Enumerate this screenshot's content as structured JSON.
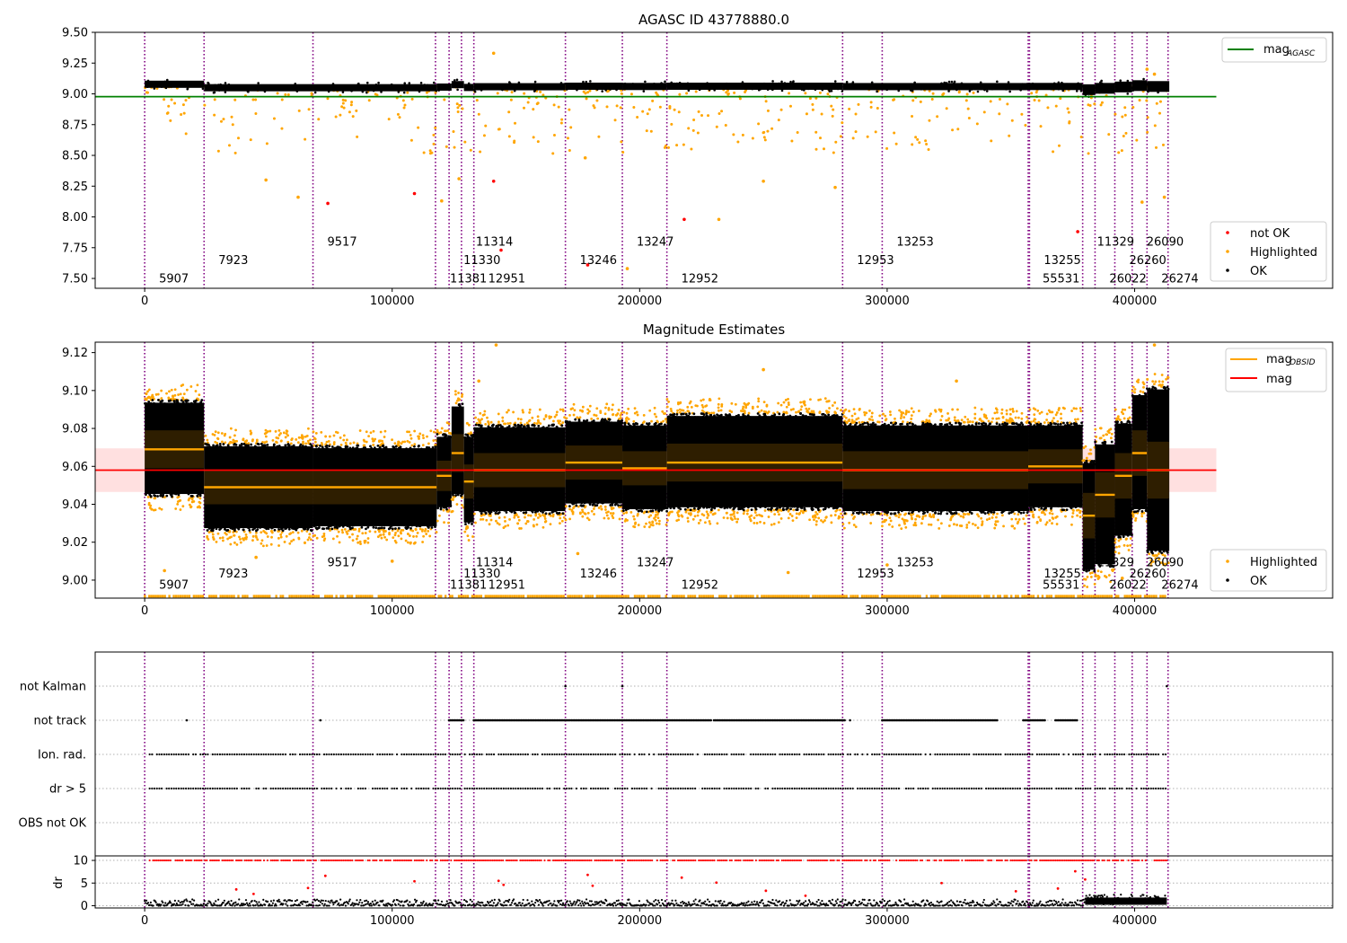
{
  "chart_data": [
    {
      "type": "scatter",
      "title": "AGASC ID 43778880.0",
      "xlim": [
        -20000,
        480000
      ],
      "ylim": [
        7.42,
        9.5
      ],
      "xticks": [
        0,
        100000,
        200000,
        300000,
        400000
      ],
      "yticks": [
        7.5,
        7.75,
        8.0,
        8.25,
        8.5,
        8.75,
        9.0,
        9.25,
        9.5
      ],
      "mag_agasc": 8.977,
      "mag_agasc_xrange": [
        -20000,
        433000
      ],
      "legend_upper": {
        "position": "upper right",
        "entries": [
          {
            "label": "mag",
            "subscript": "AGASC",
            "color": "#008000"
          }
        ]
      },
      "legend_lower": {
        "position": "lower right",
        "entries": [
          {
            "label": "not OK",
            "color": "#ff0000"
          },
          {
            "label": "Highlighted",
            "color": "#ffa500"
          },
          {
            "label": "OK",
            "color": "#000000"
          }
        ]
      },
      "segments": [
        {
          "x0": 0,
          "x1": 24000,
          "mag": 9.078
        },
        {
          "x0": 24000,
          "x1": 68000,
          "mag": 9.05
        },
        {
          "x0": 68000,
          "x1": 118000,
          "mag": 9.05
        },
        {
          "x0": 118000,
          "x1": 124000,
          "mag": 9.055
        },
        {
          "x0": 124000,
          "x1": 129000,
          "mag": 9.075
        },
        {
          "x0": 129000,
          "x1": 133000,
          "mag": 9.052
        },
        {
          "x0": 133000,
          "x1": 170000,
          "mag": 9.058
        },
        {
          "x0": 170000,
          "x1": 193000,
          "mag": 9.062
        },
        {
          "x0": 193000,
          "x1": 211000,
          "mag": 9.06
        },
        {
          "x0": 211000,
          "x1": 282000,
          "mag": 9.062
        },
        {
          "x0": 282000,
          "x1": 357000,
          "mag": 9.059
        },
        {
          "x0": 357000,
          "x1": 379000,
          "mag": 9.06
        },
        {
          "x0": 379000,
          "x1": 384000,
          "mag": 9.034
        },
        {
          "x0": 384000,
          "x1": 392000,
          "mag": 9.045
        },
        {
          "x0": 392000,
          "x1": 399000,
          "mag": 9.056
        },
        {
          "x0": 399000,
          "x1": 405000,
          "mag": 9.067
        },
        {
          "x0": 405000,
          "x1": 414000,
          "mag": 9.06
        }
      ],
      "not_ok_points": [
        {
          "x": 74000,
          "y": 8.11
        },
        {
          "x": 109000,
          "y": 8.19
        },
        {
          "x": 141000,
          "y": 8.29
        },
        {
          "x": 144000,
          "y": 7.73
        },
        {
          "x": 179000,
          "y": 7.61
        },
        {
          "x": 218000,
          "y": 7.98
        },
        {
          "x": 377000,
          "y": 7.88
        }
      ],
      "highlight_points": [
        {
          "x": 141000,
          "y": 9.33
        },
        {
          "x": 49000,
          "y": 8.3
        },
        {
          "x": 62000,
          "y": 8.16
        },
        {
          "x": 250000,
          "y": 8.29
        },
        {
          "x": 232000,
          "y": 7.98
        },
        {
          "x": 195000,
          "y": 7.58
        },
        {
          "x": 279000,
          "y": 8.24
        },
        {
          "x": 403000,
          "y": 8.12
        },
        {
          "x": 412000,
          "y": 8.16
        },
        {
          "x": 178000,
          "y": 8.48
        },
        {
          "x": 120000,
          "y": 8.13
        },
        {
          "x": 127000,
          "y": 8.31
        },
        {
          "x": 405000,
          "y": 9.2
        },
        {
          "x": 408000,
          "y": 9.16
        }
      ]
    },
    {
      "type": "scatter",
      "title": "Magnitude Estimates",
      "xlim": [
        -20000,
        480000
      ],
      "ylim": [
        8.9905,
        9.1255
      ],
      "xticks": [
        0,
        100000,
        200000,
        300000,
        400000
      ],
      "yticks": [
        9.0,
        9.02,
        9.04,
        9.06,
        9.08,
        9.1,
        9.12
      ],
      "mag": 9.058,
      "mag_band": [
        9.0465,
        9.0695
      ],
      "mag_xrange": [
        -20000,
        433000
      ],
      "legend_upper": {
        "position": "upper right",
        "entries": [
          {
            "label": "mag",
            "subscript": "OBSID",
            "color": "#ffa500"
          },
          {
            "label": "mag",
            "subscript": "",
            "color": "#ff0000"
          }
        ]
      },
      "legend_lower": {
        "position": "lower right",
        "entries": [
          {
            "label": "Highlighted",
            "color": "#ffa500"
          },
          {
            "label": "OK",
            "color": "#000000"
          }
        ]
      },
      "obsid_segments": [
        {
          "x0": 0,
          "x1": 24000,
          "mag": 9.069,
          "lo": 9.044,
          "hi": 9.095,
          "std": 0.01
        },
        {
          "x0": 24000,
          "x1": 68000,
          "mag": 9.049,
          "lo": 9.026,
          "hi": 9.072,
          "std": 0.009
        },
        {
          "x0": 68000,
          "x1": 118000,
          "mag": 9.049,
          "lo": 9.027,
          "hi": 9.071,
          "std": 0.009
        },
        {
          "x0": 118000,
          "x1": 124000,
          "mag": 9.055,
          "lo": 9.037,
          "hi": 9.077,
          "std": 0.008
        },
        {
          "x0": 124000,
          "x1": 129000,
          "mag": 9.067,
          "lo": 9.044,
          "hi": 9.093,
          "std": 0.01
        },
        {
          "x0": 129000,
          "x1": 133000,
          "mag": 9.052,
          "lo": 9.029,
          "hi": 9.077,
          "std": 0.009
        },
        {
          "x0": 133000,
          "x1": 170000,
          "mag": 9.058,
          "lo": 9.035,
          "hi": 9.082,
          "std": 0.009
        },
        {
          "x0": 170000,
          "x1": 193000,
          "mag": 9.062,
          "lo": 9.039,
          "hi": 9.085,
          "std": 0.009
        },
        {
          "x0": 193000,
          "x1": 211000,
          "mag": 9.059,
          "lo": 9.036,
          "hi": 9.083,
          "std": 0.009
        },
        {
          "x0": 211000,
          "x1": 282000,
          "mag": 9.062,
          "lo": 9.037,
          "hi": 9.088,
          "std": 0.01
        },
        {
          "x0": 282000,
          "x1": 357000,
          "mag": 9.058,
          "lo": 9.035,
          "hi": 9.083,
          "std": 0.01
        },
        {
          "x0": 357000,
          "x1": 379000,
          "mag": 9.06,
          "lo": 9.037,
          "hi": 9.083,
          "std": 0.009
        },
        {
          "x0": 379000,
          "x1": 384000,
          "mag": 9.034,
          "lo": 9.004,
          "hi": 9.063,
          "std": 0.012
        },
        {
          "x0": 384000,
          "x1": 392000,
          "mag": 9.045,
          "lo": 9.007,
          "hi": 9.073,
          "std": 0.012
        },
        {
          "x0": 392000,
          "x1": 399000,
          "mag": 9.055,
          "lo": 9.022,
          "hi": 9.084,
          "std": 0.012
        },
        {
          "x0": 399000,
          "x1": 405000,
          "mag": 9.067,
          "lo": 9.036,
          "hi": 9.099,
          "std": 0.012
        },
        {
          "x0": 405000,
          "x1": 414000,
          "mag": 9.058,
          "lo": 9.014,
          "hi": 9.102,
          "std": 0.015
        }
      ],
      "highlight_points": [
        {
          "x": 142000,
          "y": 9.124
        },
        {
          "x": 250000,
          "y": 9.111
        },
        {
          "x": 408000,
          "y": 9.124
        },
        {
          "x": 135000,
          "y": 9.105
        },
        {
          "x": 328000,
          "y": 9.105
        },
        {
          "x": 8000,
          "y": 9.005
        },
        {
          "x": 45000,
          "y": 9.012
        },
        {
          "x": 100000,
          "y": 9.01
        },
        {
          "x": 175000,
          "y": 9.014
        },
        {
          "x": 260000,
          "y": 9.004
        },
        {
          "x": 300000,
          "y": 9.008
        },
        {
          "x": 395000,
          "y": 9.001
        }
      ],
      "floor_value": 8.9915
    },
    {
      "type": "scatter",
      "title": "",
      "xlim": [
        -20000,
        480000
      ],
      "xticks": [
        0,
        100000,
        200000,
        300000,
        400000
      ],
      "flag_rows": [
        {
          "label": "not Kalman",
          "spans": [
            [
              170000,
              170500
            ],
            [
              193000,
              193500
            ],
            [
              413000,
              413500
            ]
          ]
        },
        {
          "label": "not track",
          "spans": [
            [
              17000,
              17500
            ],
            [
              71000,
              71500
            ],
            [
              123000,
              129000
            ],
            [
              133000,
              229000
            ],
            [
              230000,
              283000
            ],
            [
              285000,
              286000
            ],
            [
              298000,
              345000
            ],
            [
              355000,
              364000
            ],
            [
              368000,
              377000
            ]
          ]
        },
        {
          "label": "Ion. rad.",
          "spans": [
            [
              2000,
              413000
            ]
          ]
        },
        {
          "label": "dr > 5",
          "spans": [
            [
              2000,
              413000
            ]
          ]
        },
        {
          "label": "OBS not OK",
          "spans": []
        }
      ],
      "dr": {
        "ylabel": "dr",
        "ylim": [
          -0.5,
          11
        ],
        "yticks": [
          0,
          5,
          10
        ],
        "saturation": 10,
        "outliers": [
          {
            "x": 37000,
            "y": 3.6
          },
          {
            "x": 44000,
            "y": 2.6
          },
          {
            "x": 66000,
            "y": 3.9
          },
          {
            "x": 73000,
            "y": 6.6
          },
          {
            "x": 109000,
            "y": 5.4
          },
          {
            "x": 143000,
            "y": 5.5
          },
          {
            "x": 145000,
            "y": 4.6
          },
          {
            "x": 179000,
            "y": 6.8
          },
          {
            "x": 181000,
            "y": 4.4
          },
          {
            "x": 217000,
            "y": 6.2
          },
          {
            "x": 231000,
            "y": 5.1
          },
          {
            "x": 251000,
            "y": 3.3
          },
          {
            "x": 267000,
            "y": 2.2
          },
          {
            "x": 322000,
            "y": 5.0
          },
          {
            "x": 352000,
            "y": 3.2
          },
          {
            "x": 369000,
            "y": 3.8
          },
          {
            "x": 376000,
            "y": 7.6
          },
          {
            "x": 380000,
            "y": 5.8
          }
        ]
      }
    }
  ],
  "obsids": [
    {
      "x": 0,
      "label": "5907",
      "row": 0
    },
    {
      "x": 24000,
      "label": "7923",
      "row": 1
    },
    {
      "x": 68000,
      "label": "9517",
      "row": 2
    },
    {
      "x": 117500,
      "label": "11381",
      "row": 0
    },
    {
      "x": 123000,
      "label": "11330",
      "row": 1
    },
    {
      "x": 128000,
      "label": "11314",
      "row": 2
    },
    {
      "x": 133000,
      "label": "12951",
      "row": 0
    },
    {
      "x": 170000,
      "label": "13246",
      "row": 1
    },
    {
      "x": 193000,
      "label": "13247",
      "row": 2
    },
    {
      "x": 211000,
      "label": "12952",
      "row": 0
    },
    {
      "x": 282000,
      "label": "12953",
      "row": 1
    },
    {
      "x": 298000,
      "label": "13253",
      "row": 2
    },
    {
      "x": 357000,
      "label": "55531",
      "row": 0
    },
    {
      "x": 357500,
      "label": "13255",
      "row": 1
    },
    {
      "x": 379000,
      "label": "11329",
      "row": 2
    },
    {
      "x": 384000,
      "label": "26022",
      "row": 0
    },
    {
      "x": 392000,
      "label": "26260",
      "row": 1
    },
    {
      "x": 399000,
      "label": "26090",
      "row": 2
    },
    {
      "x": 405000,
      "label": "26274",
      "row": 0
    },
    {
      "x": 413500,
      "label": "",
      "row": 0
    }
  ],
  "colors": {
    "ok": "#000000",
    "highlighted": "#ffa500",
    "not_ok": "#ff0000",
    "agasc_line": "#008000",
    "mag_line": "#ff0000",
    "obsid_line": "#ffa500",
    "obsid_boundary": "#800080",
    "band_fill": "#ffe0e0"
  }
}
